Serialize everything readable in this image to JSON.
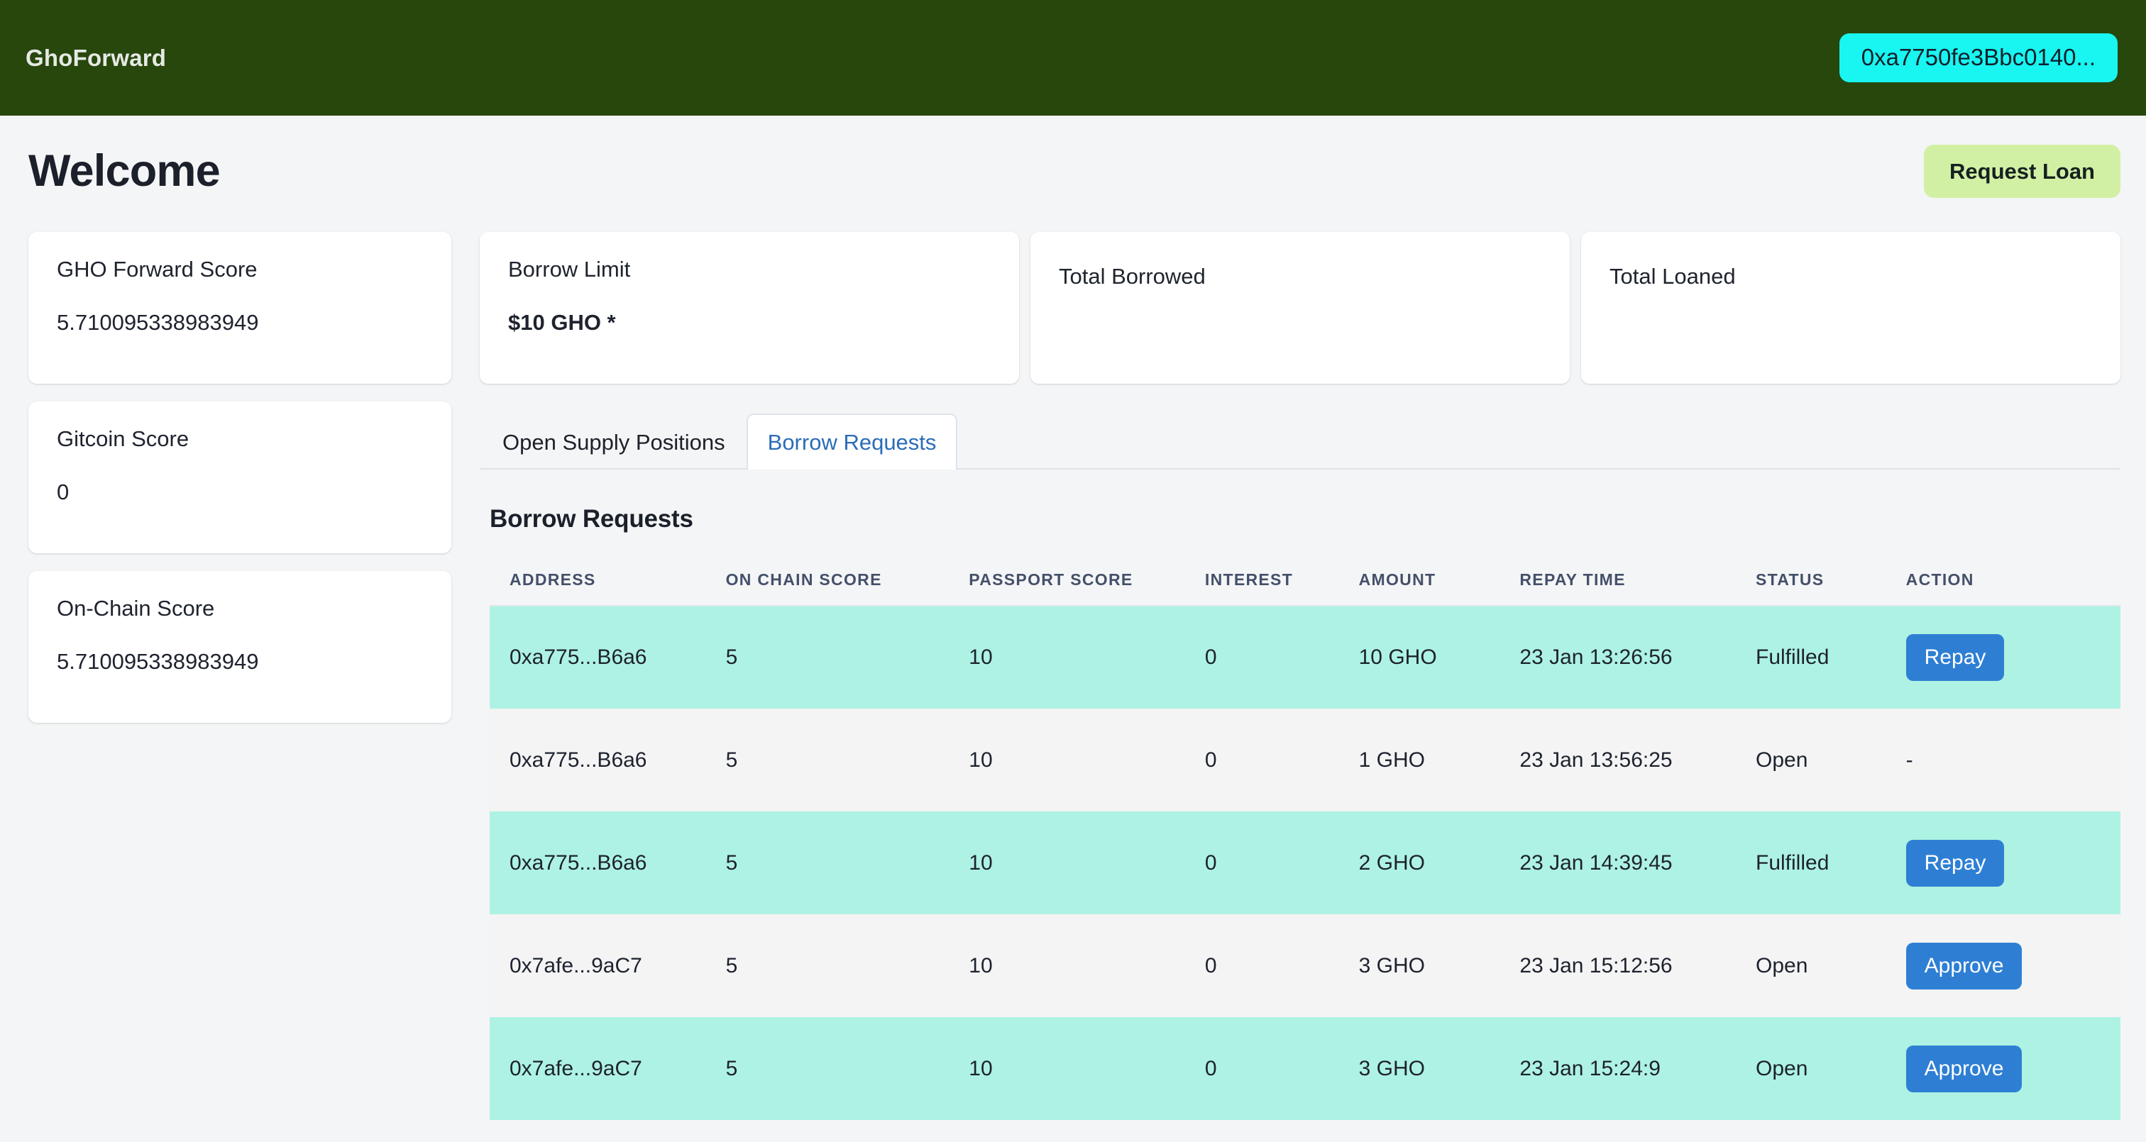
{
  "navbar": {
    "brand": "GhoForward",
    "wallet_address": "0xa7750fe3Bbc0140...",
    "bg_color": "#27470d",
    "wallet_color": "#19f5f1"
  },
  "page": {
    "title": "Welcome",
    "request_loan_label": "Request Loan",
    "request_loan_color": "#d2f0a3"
  },
  "left_cards": [
    {
      "label": "GHO Forward Score",
      "value": "5.710095338983949"
    },
    {
      "label": "Gitcoin Score",
      "value": "0"
    },
    {
      "label": "On-Chain Score",
      "value": "5.710095338983949"
    }
  ],
  "stat_cards": [
    {
      "label": "Borrow Limit",
      "value": "$10 GHO *",
      "bold": true
    },
    {
      "label": "Total Borrowed",
      "value": ""
    },
    {
      "label": "Total Loaned",
      "value": ""
    }
  ],
  "tabs": [
    {
      "label": "Open Supply Positions",
      "active": false
    },
    {
      "label": "Borrow Requests",
      "active": true
    }
  ],
  "table": {
    "section_title": "Borrow Requests",
    "columns": [
      "ADDRESS",
      "ON CHAIN SCORE",
      "PASSPORT SCORE",
      "INTEREST",
      "AMOUNT",
      "REPAY TIME",
      "STATUS",
      "ACTION"
    ],
    "rows": [
      {
        "address": "0xa775...B6a6",
        "on_chain_score": "5",
        "passport_score": "10",
        "interest": "0",
        "amount": "10 GHO",
        "repay_time": "23 Jan 13:26:56",
        "status": "Fulfilled",
        "action": "Repay",
        "highlighted": true
      },
      {
        "address": "0xa775...B6a6",
        "on_chain_score": "5",
        "passport_score": "10",
        "interest": "0",
        "amount": "1 GHO",
        "repay_time": "23 Jan 13:56:25",
        "status": "Open",
        "action": "-",
        "highlighted": false
      },
      {
        "address": "0xa775...B6a6",
        "on_chain_score": "5",
        "passport_score": "10",
        "interest": "0",
        "amount": "2 GHO",
        "repay_time": "23 Jan 14:39:45",
        "status": "Fulfilled",
        "action": "Repay",
        "highlighted": true
      },
      {
        "address": "0x7afe...9aC7",
        "on_chain_score": "5",
        "passport_score": "10",
        "interest": "0",
        "amount": "3 GHO",
        "repay_time": "23 Jan 15:12:56",
        "status": "Open",
        "action": "Approve",
        "highlighted": false
      },
      {
        "address": "0x7afe...9aC7",
        "on_chain_score": "5",
        "passport_score": "10",
        "interest": "0",
        "amount": "3 GHO",
        "repay_time": "23 Jan 15:24:9",
        "status": "Open",
        "action": "Approve",
        "highlighted": true
      }
    ],
    "highlight_color": "#aef2e3",
    "action_button_color": "#2e7fd4"
  }
}
